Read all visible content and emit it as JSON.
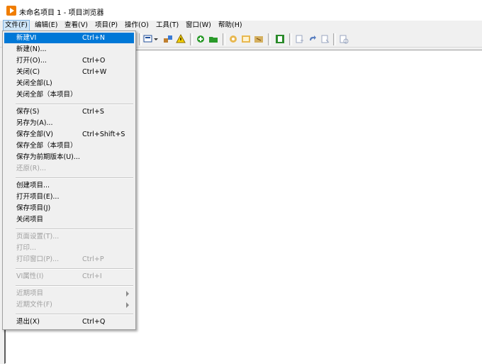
{
  "window": {
    "title": "未命名项目 1 - 项目浏览器"
  },
  "menubar": {
    "items": [
      {
        "label": "文件(F)"
      },
      {
        "label": "编辑(E)"
      },
      {
        "label": "查看(V)"
      },
      {
        "label": "项目(P)"
      },
      {
        "label": "操作(O)"
      },
      {
        "label": "工具(T)"
      },
      {
        "label": "窗口(W)"
      },
      {
        "label": "帮助(H)"
      }
    ]
  },
  "file_menu": {
    "items": [
      {
        "label": "新建VI",
        "shortcut": "Ctrl+N"
      },
      {
        "label": "新建(N)...",
        "shortcut": ""
      },
      {
        "label": "打开(O)...",
        "shortcut": "Ctrl+O"
      },
      {
        "label": "关闭(C)",
        "shortcut": "Ctrl+W"
      },
      {
        "label": "关闭全部(L)",
        "shortcut": ""
      },
      {
        "label": "关闭全部（本项目）",
        "shortcut": ""
      },
      {
        "label": "保存(S)",
        "shortcut": "Ctrl+S"
      },
      {
        "label": "另存为(A)...",
        "shortcut": ""
      },
      {
        "label": "保存全部(V)",
        "shortcut": "Ctrl+Shift+S"
      },
      {
        "label": "保存全部（本项目）",
        "shortcut": ""
      },
      {
        "label": "保存为前期版本(U)...",
        "shortcut": ""
      },
      {
        "label": "还原(R)...",
        "shortcut": ""
      },
      {
        "label": "创建项目...",
        "shortcut": ""
      },
      {
        "label": "打开项目(E)...",
        "shortcut": ""
      },
      {
        "label": "保存项目(J)",
        "shortcut": ""
      },
      {
        "label": "关闭项目",
        "shortcut": ""
      },
      {
        "label": "页面设置(T)...",
        "shortcut": ""
      },
      {
        "label": "打印...",
        "shortcut": ""
      },
      {
        "label": "打印窗口(P)...",
        "shortcut": "Ctrl+P"
      },
      {
        "label": "VI属性(I)",
        "shortcut": "Ctrl+I"
      },
      {
        "label": "近期项目",
        "shortcut": ""
      },
      {
        "label": "近期文件(F)",
        "shortcut": ""
      },
      {
        "label": "退出(X)",
        "shortcut": "Ctrl+Q"
      }
    ]
  },
  "icons": {
    "app": "labview-project-icon",
    "toolbar": [
      "new-vi-icon",
      "open-icon",
      "save-icon",
      "save-all-icon",
      "cut-icon",
      "copy-icon",
      "paste-icon",
      "delete-icon",
      "build-icon",
      "deploy-icon",
      "warning-icon",
      "add-file-icon",
      "add-folder-icon",
      "settings-icon",
      "web-icon",
      "code-icon",
      "files-view-icon",
      "undo-icon",
      "redo-icon",
      "refresh-icon",
      "help-icon"
    ]
  },
  "colors": {
    "selection": "#0078d7",
    "app_icon": "#f07d00"
  }
}
